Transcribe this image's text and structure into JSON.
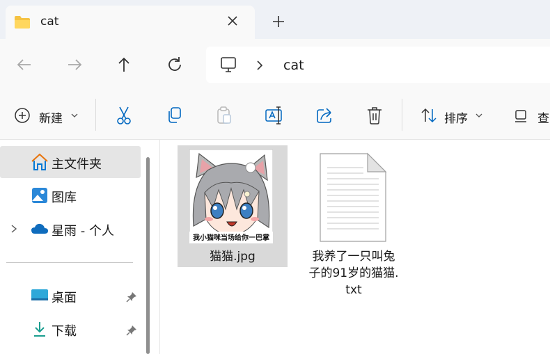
{
  "tab": {
    "title": "cat",
    "folder_icon": "folder-icon",
    "close_icon": "close-icon"
  },
  "new_tab_icon": "plus-icon",
  "nav": {
    "back": "back-arrow-icon",
    "forward": "forward-arrow-icon",
    "up": "up-arrow-icon",
    "refresh": "refresh-icon"
  },
  "address": {
    "root_icon": "computer-icon",
    "crumbs": [
      "cat"
    ]
  },
  "toolbar": {
    "new_label": "新建",
    "sort_label": "排序",
    "view_label": "查",
    "icons": [
      "cut-icon",
      "copy-icon",
      "paste-icon",
      "rename-icon",
      "share-icon",
      "delete-icon"
    ]
  },
  "sidebar": {
    "items": [
      {
        "label": "主文件夹",
        "icon": "home-icon",
        "selected": true
      },
      {
        "label": "图库",
        "icon": "gallery-icon"
      },
      {
        "label": "星雨 - 个人",
        "icon": "onedrive-cloud-icon",
        "expandable": true
      }
    ],
    "pinned": [
      {
        "label": "桌面",
        "icon": "desktop-icon",
        "pinned": true
      },
      {
        "label": "下载",
        "icon": "download-icon",
        "pinned": true
      }
    ]
  },
  "files": [
    {
      "name": "猫猫.jpg",
      "type": "image",
      "selected": true,
      "thumb_caption": "我小猫咪当场给你一巴掌"
    },
    {
      "name_line1": "我养了一只叫兔",
      "name_line2": "子的91岁的猫猫.",
      "name_line3": "txt",
      "type": "text"
    }
  ],
  "colors": {
    "accent": "#0067c0",
    "selection": "#d9d9d9",
    "tab_strip": "#eef1f6"
  }
}
